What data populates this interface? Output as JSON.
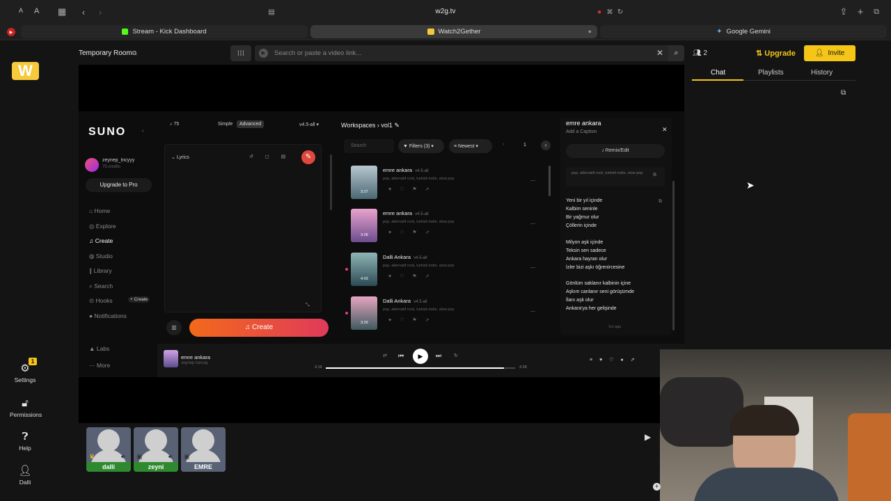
{
  "browser": {
    "font_small": "A",
    "font_large": "A",
    "url": "w2g.tv",
    "tabs": [
      {
        "label": "Stream - Kick Dashboard"
      },
      {
        "label": "Watch2Gether"
      },
      {
        "label": "Google Gemini"
      }
    ]
  },
  "room": {
    "title": "Temporary Room",
    "search_placeholder": "Search or paste a video link...",
    "user_count": "2",
    "upgrade_label": "Upgrade",
    "invite_label": "Invite"
  },
  "right_panel": {
    "tabs": [
      "Chat",
      "Playlists",
      "History"
    ],
    "active_tab": "Chat"
  },
  "left_sidebar": {
    "settings_badge": "1",
    "items": [
      {
        "label": "Settings",
        "icon": "gear-icon"
      },
      {
        "label": "Permissions",
        "icon": "lock-icon"
      },
      {
        "label": "Help",
        "icon": "help-icon"
      },
      {
        "label": "Dalli",
        "icon": "user-icon"
      }
    ]
  },
  "suno": {
    "logo": "SUNO",
    "credits_top": "75",
    "mode_simple": "Simple",
    "mode_advanced": "Advanced",
    "model": "v4.5-all",
    "user_name": "zeynep_tncyyy",
    "user_credits": "75 credits",
    "upgrade": "Upgrade to Pro",
    "nav": [
      "Home",
      "Explore",
      "Create",
      "Studio",
      "Library",
      "Search",
      "Hooks",
      "Notifications"
    ],
    "hooks_create": "+ Create",
    "nav_bottom": [
      "Labs",
      "More"
    ],
    "lyrics_label": "Lyrics",
    "create_button": "Create",
    "workspace_crumb": "Workspaces",
    "workspace_name": "vol1",
    "search_placeholder": "Search",
    "filters": "Filters (3)",
    "sort": "Newest",
    "page": "1",
    "songs": [
      {
        "title": "emre ankara",
        "version": "v4.5-all",
        "tags": "pop, alternatif rock, turkish indie, slow pop",
        "duration": "3:27",
        "color": "#5a7a8a"
      },
      {
        "title": "emre ankara",
        "version": "v4.5-all",
        "tags": "pop, alternatif rock, turkish indie, slow pop",
        "duration": "3:28",
        "color": "#c07aa8"
      },
      {
        "title": "Dalli Ankara",
        "version": "v4.5-all",
        "tags": "pop, alternatif rock, turkish indie, slow pop",
        "duration": "4:03",
        "color": "#4f7b80"
      },
      {
        "title": "Dalli Ankara",
        "version": "v4.5-all",
        "tags": "pop, alternatif rock, turkish indie, slow pop",
        "duration": "3:29",
        "color": "#b27490"
      }
    ],
    "detail": {
      "title": "emre ankara",
      "caption": "Add a Caption",
      "remix": "Remix/Edit",
      "tags": "pop, alternatif rock, turkish indie, slow pop",
      "stanza1": [
        "Yeni bir yıl içinde",
        "Kalbim seninle",
        "Bir yağmur olur",
        "Çöllerin içinde"
      ],
      "stanza2": [
        "Milyon aşk içinde",
        "Teksin sen sadece",
        "Ankara hayran olur",
        "İzler bizi aşkı öğrenircesine"
      ],
      "stanza3": [
        "Gönlüm saklanır kalbinin içine",
        "Aşkım canlanır seni görüşümde",
        "İlanı aşk olur",
        "Ankara'ya her gelişinde"
      ],
      "time": "1m ago"
    },
    "player": {
      "title": "emre ankara",
      "artist": "zeynep tuncay",
      "elapsed": "3:16",
      "total": "3:28",
      "progress": 0.94
    }
  },
  "users": [
    {
      "name": "dalli",
      "color": "#2f8a2f"
    },
    {
      "name": "zeyni",
      "color": "#2f8a2f"
    },
    {
      "name": "EMRE",
      "color": "#596175"
    }
  ]
}
